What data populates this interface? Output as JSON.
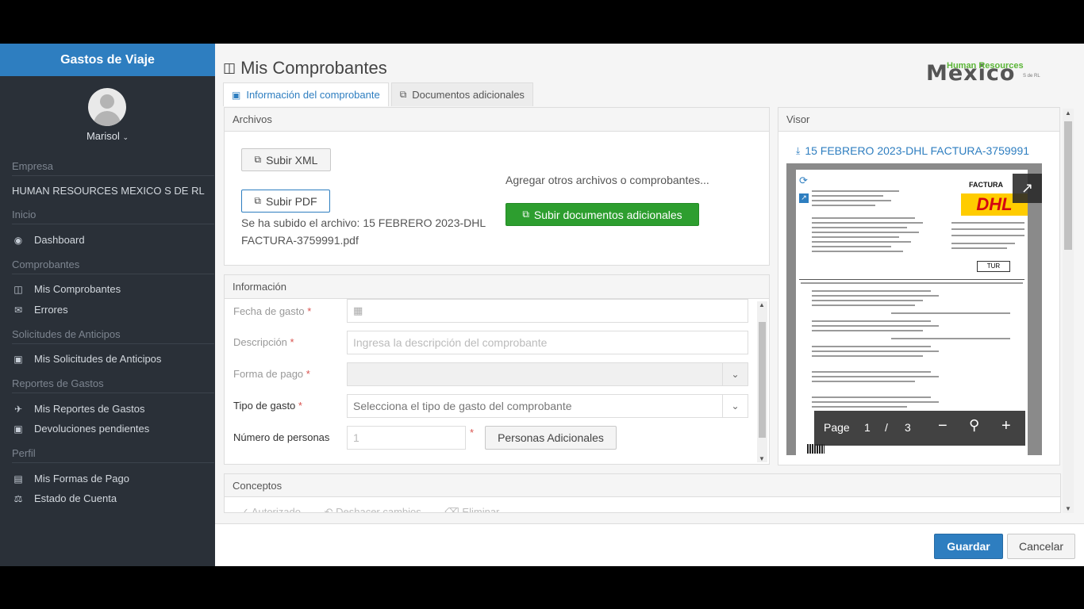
{
  "sidebar": {
    "app_title": "Gastos de Viaje",
    "user_name": "Marisol",
    "sections": {
      "empresa": "Empresa",
      "company": "HUMAN RESOURCES MEXICO S DE RL",
      "inicio": "Inicio",
      "comprobantes": "Comprobantes",
      "anticipos": "Solicitudes de Anticipos",
      "reportes": "Reportes de Gastos",
      "perfil": "Perfil"
    },
    "items": {
      "dashboard": "Dashboard",
      "mis_comprobantes": "Mis Comprobantes",
      "errores": "Errores",
      "mis_solicitudes": "Mis Solicitudes de Anticipos",
      "mis_reportes": "Mis Reportes de Gastos",
      "devoluciones": "Devoluciones pendientes",
      "formas_pago": "Mis Formas de Pago",
      "estado_cuenta": "Estado de Cuenta"
    }
  },
  "header": {
    "title": "Mis Comprobantes",
    "logo_big": "Mexico",
    "logo_small": "Human Resources",
    "logo_suffix": "S de RL"
  },
  "tabs": {
    "info": "Información del comprobante",
    "docs": "Documentos adicionales"
  },
  "archivos": {
    "title": "Archivos",
    "subir_xml": "Subir XML",
    "subir_pdf": "Subir PDF",
    "uploaded_line1": "Se ha subido el archivo: 15 FEBRERO 2023-DHL",
    "uploaded_line2": "FACTURA-3759991.pdf",
    "agregar": "Agregar otros archivos o comprobantes...",
    "subir_adicionales": "Subir documentos adicionales"
  },
  "informacion": {
    "title": "Información",
    "fecha_label": "Fecha de gasto",
    "descripcion_label": "Descripción",
    "descripcion_placeholder": "Ingresa la descripción del comprobante",
    "forma_pago_label": "Forma de pago",
    "tipo_gasto_label": "Tipo de gasto",
    "tipo_gasto_placeholder": "Selecciona el tipo de gasto del comprobante",
    "num_personas_label": "Número de personas",
    "num_personas_value": "1",
    "personas_adicionales": "Personas Adicionales",
    "required_mark": "*"
  },
  "visor": {
    "title": "Visor",
    "file_link": "15 FEBRERO 2023-DHL FACTURA-3759991",
    "doc_factura": "FACTURA",
    "doc_brand": "DHL",
    "doc_tur": "TUR",
    "pdf_page_label": "Page",
    "pdf_page_current": "1",
    "pdf_page_sep": "/",
    "pdf_page_total": "3"
  },
  "conceptos": {
    "title": "Conceptos",
    "autorizado": "Autorizado",
    "deshacer": "Deshacer cambios",
    "eliminar": "Eliminar"
  },
  "footer": {
    "guardar": "Guardar",
    "cancelar": "Cancelar"
  }
}
